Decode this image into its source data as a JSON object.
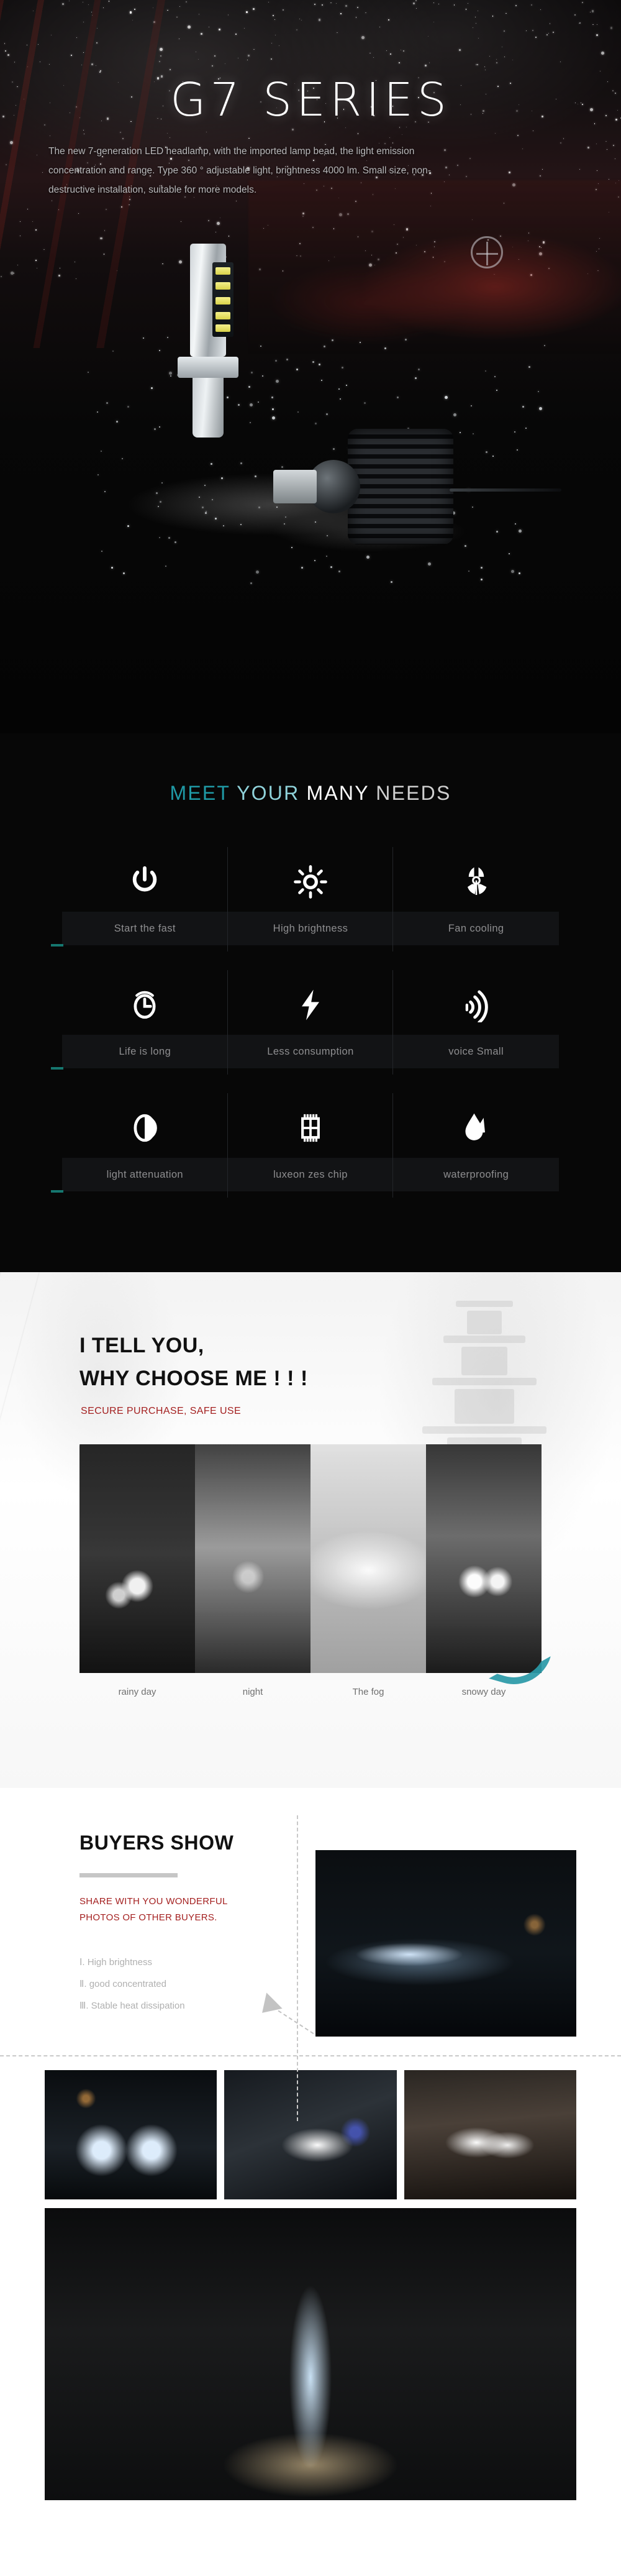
{
  "hero": {
    "title": "G7 SERIES",
    "description": "The new 7-generation LED headlamp, with the imported lamp bead, the light emission concentration and range. Type 360 ° adjustable light, brightness 4000 lm. Small size, non-destructive installation, suitable for more models."
  },
  "features": {
    "title_parts": [
      "MEET",
      "YOUR",
      "MANY",
      "NEEDS"
    ],
    "accent_color": "#1f9aa6",
    "items": [
      {
        "icon": "power-icon",
        "label": "Start the fast"
      },
      {
        "icon": "sun-icon",
        "label": "High brightness"
      },
      {
        "icon": "fan-icon",
        "label": "Fan cooling"
      },
      {
        "icon": "clock-icon",
        "label": "Life is long"
      },
      {
        "icon": "lightning-icon",
        "label": "Less consumption"
      },
      {
        "icon": "sound-wave-icon",
        "label": "voice Small"
      },
      {
        "icon": "contrast-icon",
        "label": "light attenuation"
      },
      {
        "icon": "chip-icon",
        "label": "luxeon zes chip"
      },
      {
        "icon": "water-drop-icon",
        "label": "waterproofing"
      }
    ]
  },
  "why": {
    "heading_line1": "I TELL YOU,",
    "heading_line2": "WHY CHOOSE ME ! ! !",
    "subtitle": "SECURE PURCHASE, SAFE USE",
    "subtitle_color": "#a42020",
    "cards": [
      {
        "caption": "rainy day"
      },
      {
        "caption": "night"
      },
      {
        "caption": "The fog"
      },
      {
        "caption": "snowy day"
      }
    ]
  },
  "buyers": {
    "title": "BUYERS SHOW",
    "subtitle_line1": "SHARE WITH YOU WONDERFUL",
    "subtitle_line2": "PHOTOS OF OTHER BUYERS.",
    "subtitle_color": "#a42020",
    "list": [
      "Ⅰ. High brightness",
      "Ⅱ. good concentrated",
      "Ⅲ. Stable heat dissipation"
    ]
  }
}
